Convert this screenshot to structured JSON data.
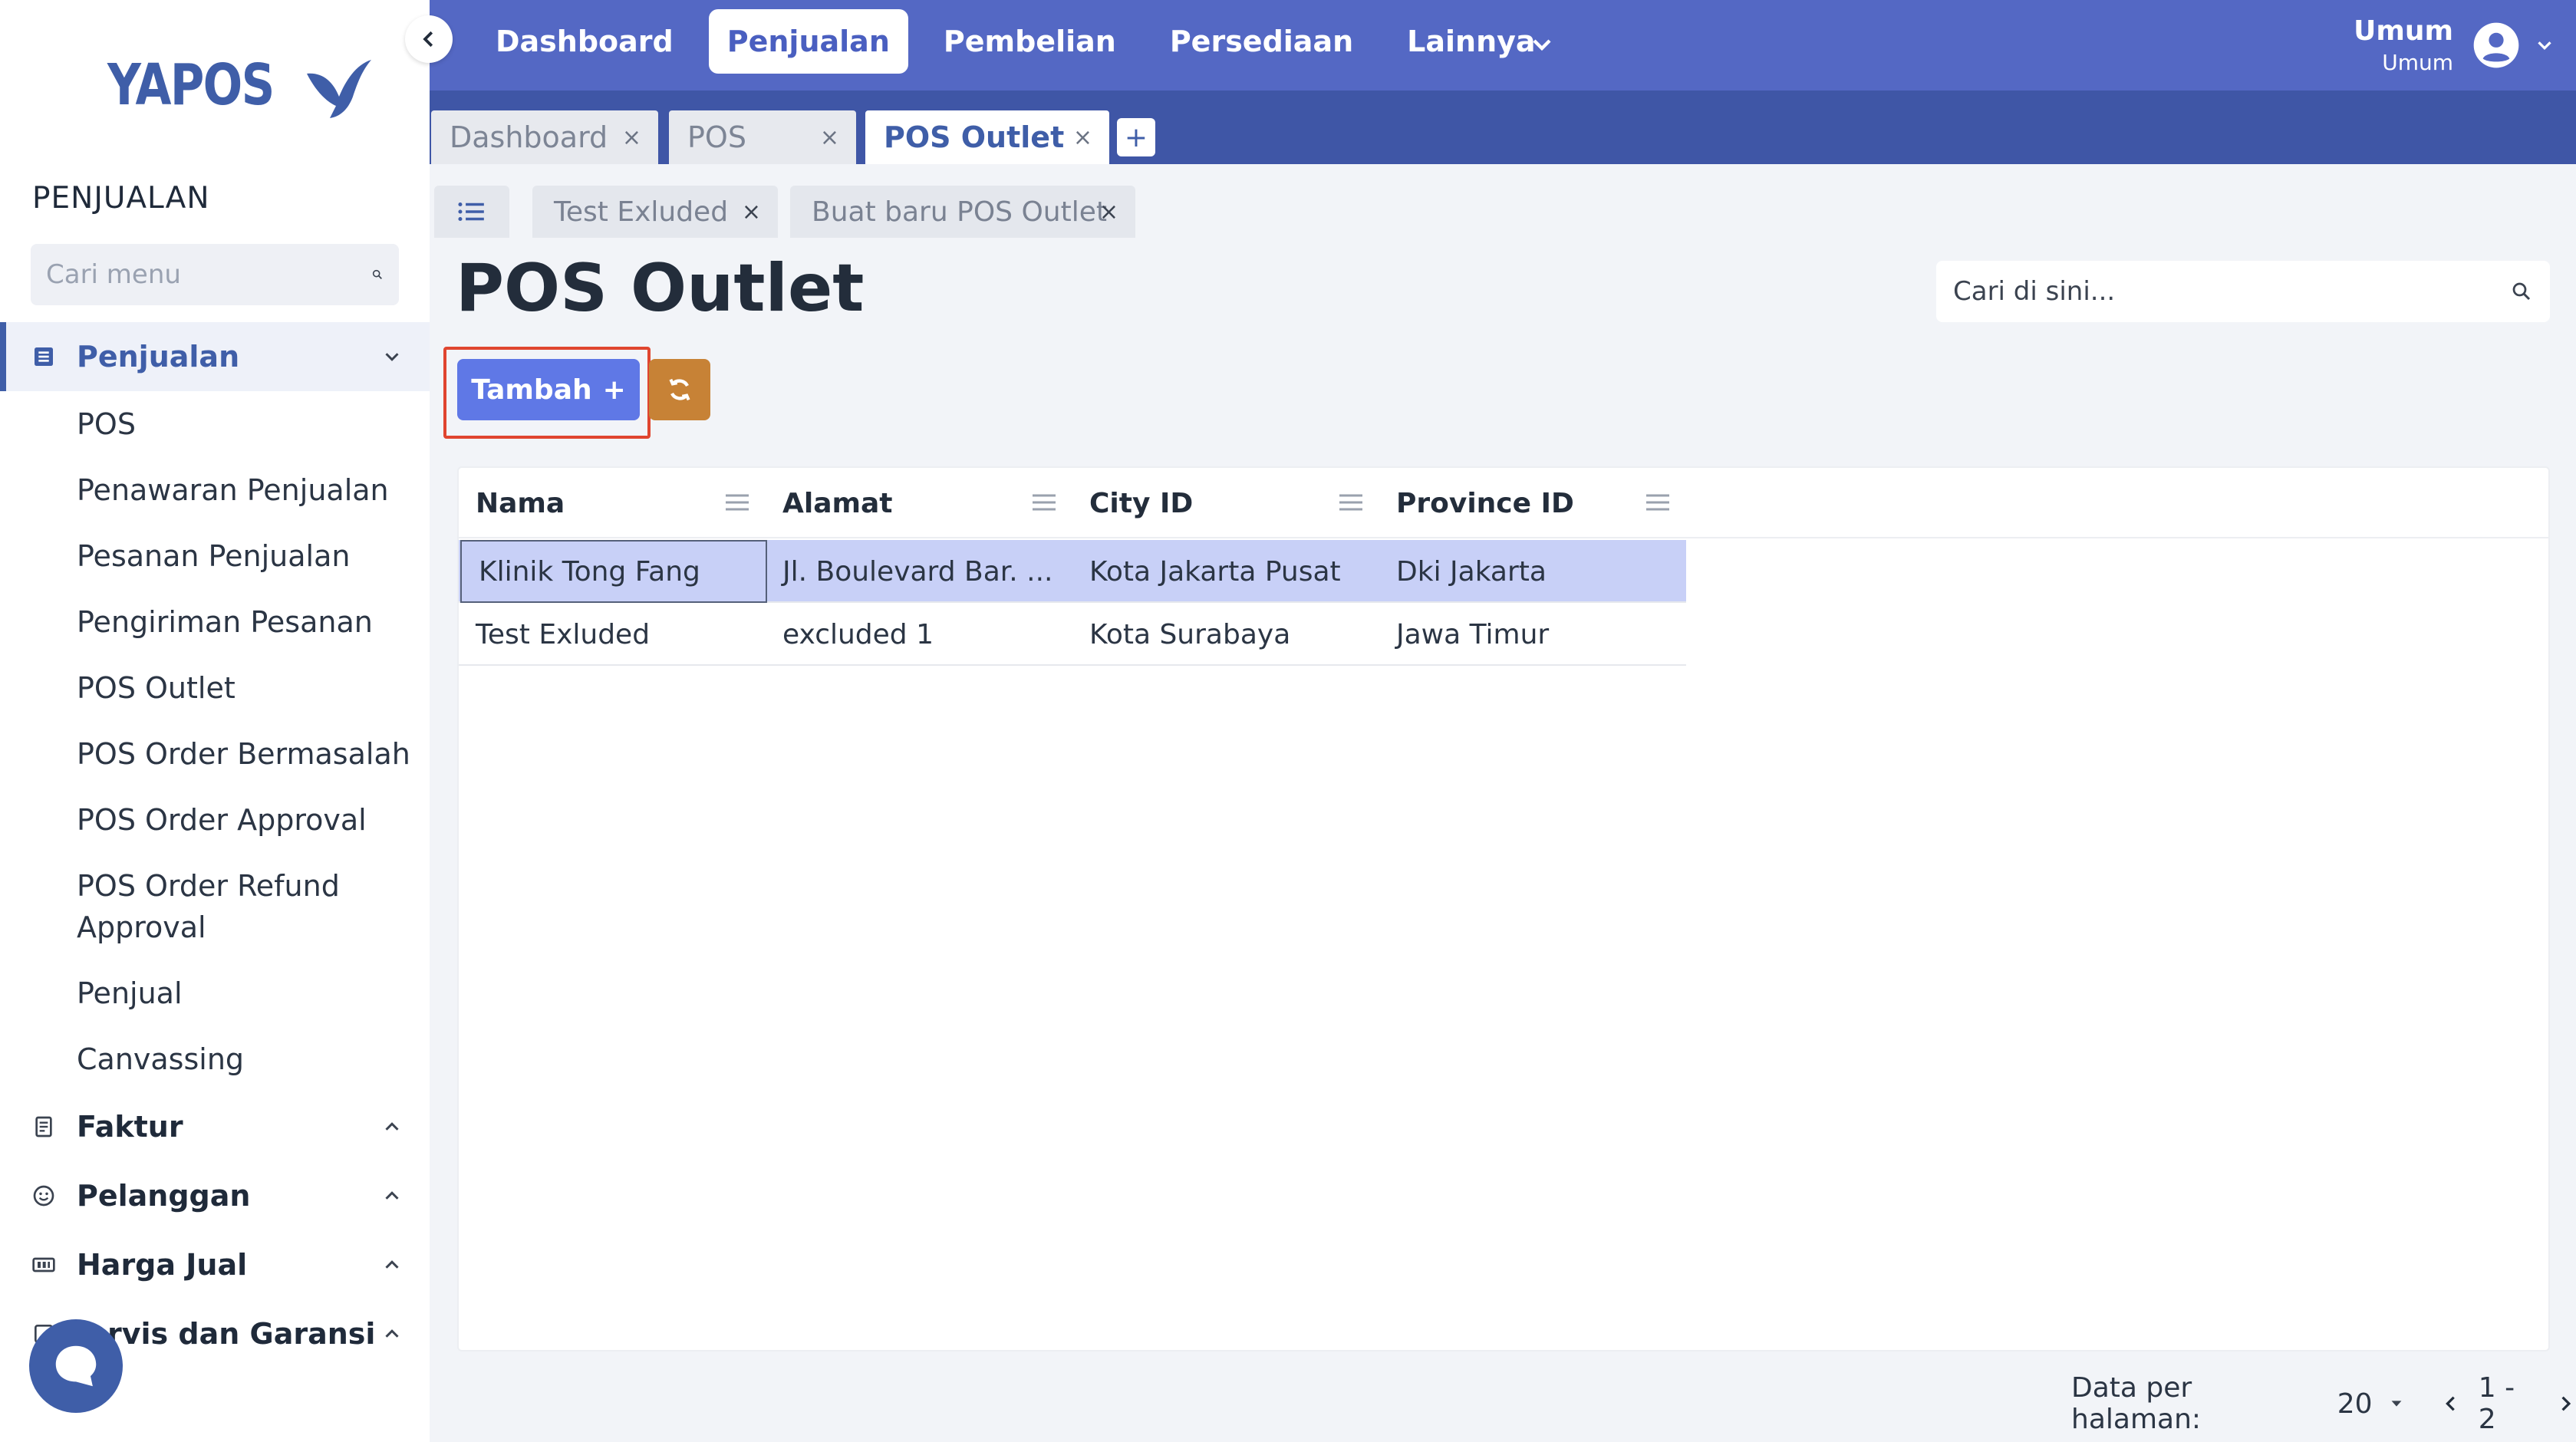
{
  "app": {
    "logo_text": "YAPOS"
  },
  "sidebar": {
    "section_title": "PENJUALAN",
    "search_placeholder": "Cari menu",
    "groups": [
      {
        "label": "Penjualan",
        "icon": "list-icon",
        "expanded": true
      },
      {
        "label": "Faktur",
        "icon": "receipt-icon"
      },
      {
        "label": "Pelanggan",
        "icon": "smile-icon"
      },
      {
        "label": "Harga Jual",
        "icon": "price-icon"
      },
      {
        "label": "rvis dan Garansi",
        "icon": "service-icon"
      }
    ],
    "items": [
      "POS",
      "Penawaran Penjualan",
      "Pesanan Penjualan",
      "Pengiriman Pesanan",
      "POS Outlet",
      "POS Order Bermasalah",
      "POS Order Approval",
      "POS Order Refund",
      "Approval",
      "Penjual",
      "Canvassing"
    ]
  },
  "topnav": {
    "items": [
      "Dashboard",
      "Penjualan",
      "Pembelian",
      "Persediaan",
      "Lainnya"
    ],
    "active": "Penjualan"
  },
  "user": {
    "name": "Umum",
    "role": "Umum"
  },
  "page_tabs": {
    "items": [
      "Dashboard",
      "POS",
      "POS Outlet"
    ],
    "active": "POS Outlet",
    "close": "×",
    "add": "+"
  },
  "sub_tabs": {
    "items": [
      "Test Exluded",
      "Buat baru POS Outlet"
    ],
    "close": "×"
  },
  "content": {
    "title": "POS Outlet",
    "search_placeholder": "Cari di sini...",
    "add_button": "Tambah",
    "add_symbol": "+"
  },
  "table": {
    "columns": [
      "Nama",
      "Alamat",
      "City ID",
      "Province ID"
    ],
    "rows": [
      [
        "Klinik Tong Fang",
        "Jl. Boulevard Bar. ...",
        "Kota Jakarta Pusat",
        "Dki Jakarta"
      ],
      [
        "Test Exluded",
        "excluded 1",
        "Kota Surabaya",
        "Jawa Timur"
      ]
    ]
  },
  "pager": {
    "label": "Data per halaman:",
    "page_size": "20",
    "range": "1 - 2"
  },
  "colors": {
    "primary": "#5468c4",
    "tab_bar": "#3f56a6",
    "add_button": "#5f78e6",
    "refresh_button": "#c78236",
    "selected_row": "#c8d0f7",
    "highlight": "#e0452f"
  }
}
